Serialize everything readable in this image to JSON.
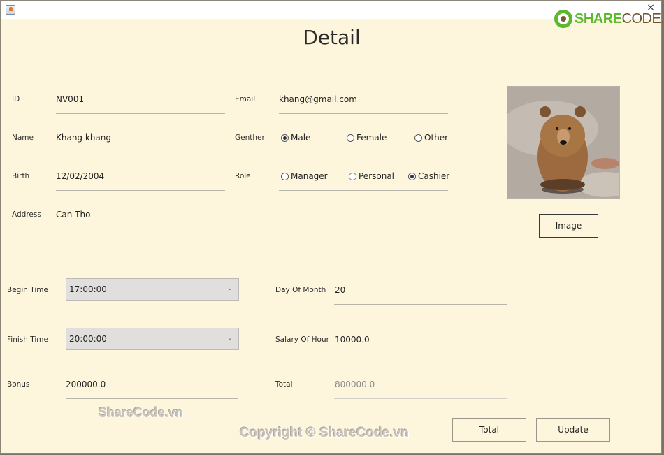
{
  "window": {
    "title": "",
    "close_glyph": "×",
    "app_icon": "java-cup-icon"
  },
  "branding": {
    "logo_bold": "SHARE",
    "logo_normal": "CODE.vn",
    "brand_green": "#5cb82e",
    "brand_brown": "#6b5334"
  },
  "page": {
    "title": "Detail",
    "background": "#fef6dc"
  },
  "personal": {
    "id": {
      "label": "ID",
      "value": "NV001"
    },
    "name": {
      "label": "Name",
      "value": "Khang khang"
    },
    "birth": {
      "label": "Birth",
      "value": "12/02/2004"
    },
    "address": {
      "label": "Address",
      "value": "Can Tho"
    },
    "email": {
      "label": "Email",
      "value": "khang@gmail.com"
    },
    "gender": {
      "label": "Genther",
      "options": [
        {
          "label": "Male",
          "checked": true
        },
        {
          "label": "Female",
          "checked": false
        },
        {
          "label": "Other",
          "checked": false
        }
      ]
    },
    "role": {
      "label": "Role",
      "options": [
        {
          "label": "Manager",
          "checked": false
        },
        {
          "label": "Personal",
          "checked": false,
          "focused": true
        },
        {
          "label": "Cashier",
          "checked": true
        }
      ]
    }
  },
  "photo": {
    "alt": "brown bear photo",
    "button_label": "Image"
  },
  "work": {
    "begin_time": {
      "label": "Begin Time",
      "value": "17:00:00"
    },
    "finish_time": {
      "label": "Finish Time",
      "value": "20:00:00"
    },
    "bonus": {
      "label": "Bonus",
      "value": "200000.0"
    },
    "day_of_month": {
      "label": "Day Of Month",
      "value": "20"
    },
    "salary_of_hour": {
      "label": "Salary Of Hour",
      "value": "10000.0"
    },
    "total": {
      "label": "Total",
      "value": "800000.0"
    }
  },
  "actions": {
    "total_label": "Total",
    "update_label": "Update"
  },
  "watermarks": {
    "small": "ShareCode.vn",
    "copyright": "Copyright © ShareCode.vn"
  }
}
